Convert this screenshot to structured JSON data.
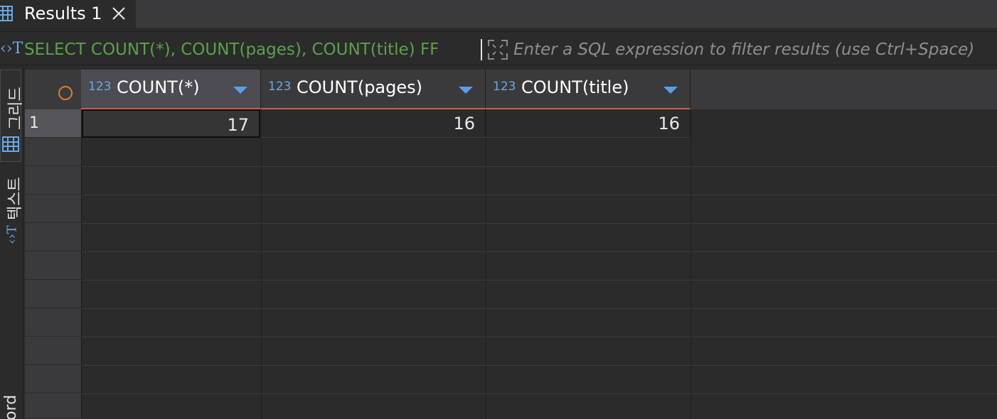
{
  "tab": {
    "label": "Results 1"
  },
  "filter": {
    "sql": "SELECT COUNT(*), COUNT(pages), COUNT(title) FF",
    "placeholder": "Enter a SQL expression to filter results (use Ctrl+Space)"
  },
  "side_panel": {
    "grid_label": "그리드",
    "text_label": "텍스트",
    "record_label": "ord"
  },
  "columns": [
    {
      "type": "123",
      "name": "COUNT(*)"
    },
    {
      "type": "123",
      "name": "COUNT(pages)"
    },
    {
      "type": "123",
      "name": "COUNT(title)"
    }
  ],
  "rows": [
    {
      "num": "1",
      "cells": [
        "17",
        "16",
        "16"
      ]
    }
  ],
  "colors": {
    "background": "#2b2b2b",
    "header": "#3a3a3c",
    "sql_green": "#5aa14a",
    "accent_blue": "#5aa0e6",
    "sort_underline": "#c8624a"
  }
}
